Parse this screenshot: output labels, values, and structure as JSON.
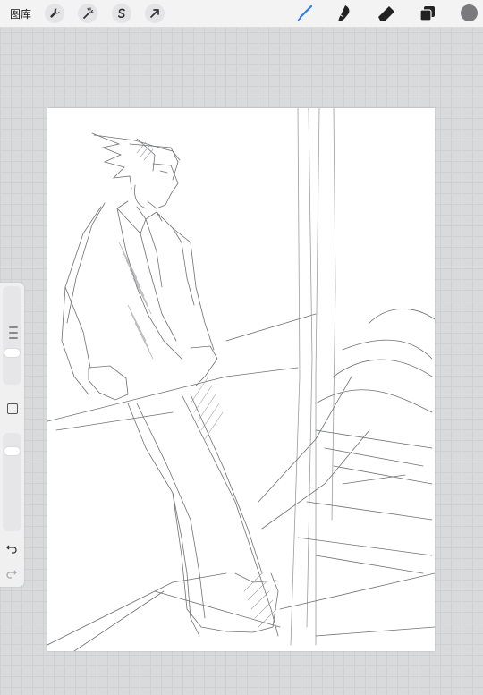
{
  "toolbar": {
    "gallery_label": "图库",
    "actions": [
      {
        "name": "wrench-icon"
      },
      {
        "name": "magic-wand-icon"
      },
      {
        "name": "selection-s-icon"
      },
      {
        "name": "transform-arrow-icon"
      }
    ],
    "tools": [
      {
        "name": "brush-icon",
        "active": true
      },
      {
        "name": "smudge-icon",
        "active": false
      },
      {
        "name": "eraser-icon",
        "active": false
      },
      {
        "name": "layers-icon",
        "active": false
      }
    ],
    "current_color": "#7a7a7c",
    "accent_color": "#2f7cf6"
  },
  "sidebar": {
    "icons": [
      "brush-size-slider",
      "modify-square-icon",
      "opacity-slider",
      "undo-icon",
      "redo-icon"
    ]
  }
}
